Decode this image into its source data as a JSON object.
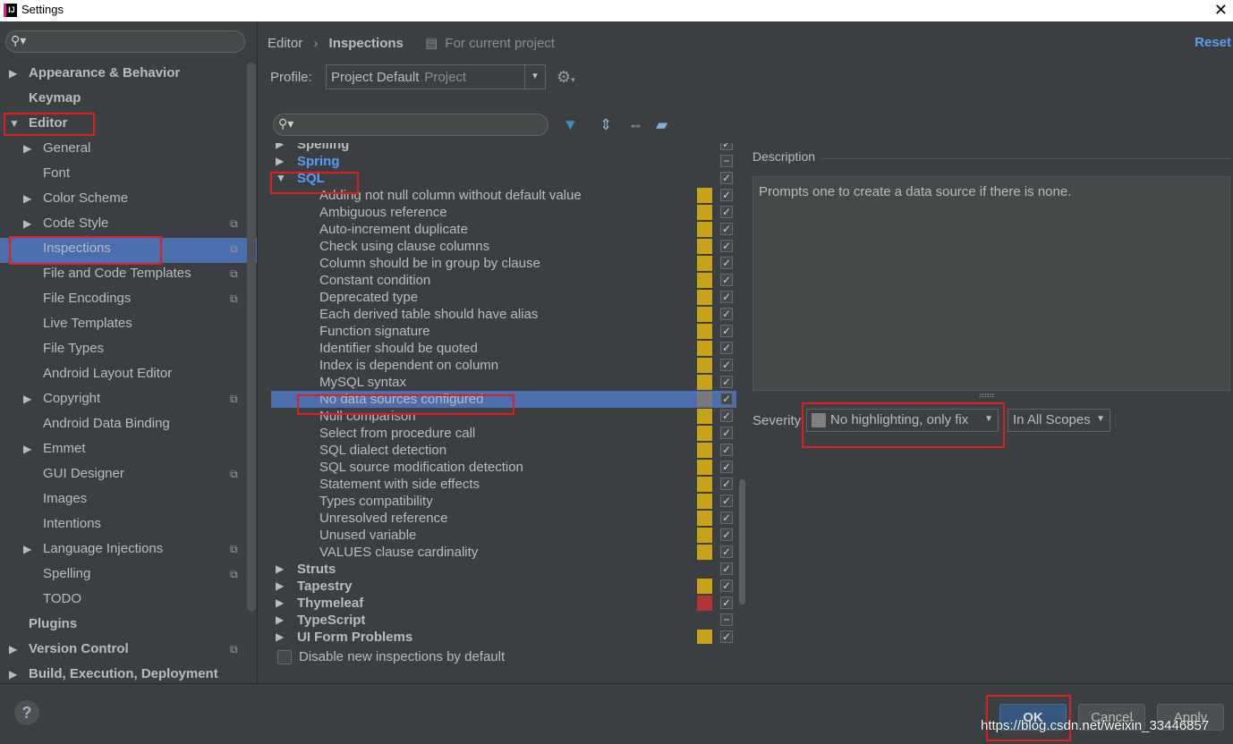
{
  "window": {
    "title": "Settings"
  },
  "left": {
    "search_placeholder": "",
    "items": [
      {
        "label": "Appearance & Behavior",
        "arrow": "▶"
      },
      {
        "label": "Keymap",
        "arrow": ""
      },
      {
        "label": "Editor",
        "arrow": "▼"
      },
      {
        "label": "General",
        "arrow": "▶"
      },
      {
        "label": "Font",
        "arrow": ""
      },
      {
        "label": "Color Scheme",
        "arrow": "▶"
      },
      {
        "label": "Code Style",
        "arrow": "▶"
      },
      {
        "label": "Inspections",
        "arrow": ""
      },
      {
        "label": "File and Code Templates",
        "arrow": ""
      },
      {
        "label": "File Encodings",
        "arrow": ""
      },
      {
        "label": "Live Templates",
        "arrow": ""
      },
      {
        "label": "File Types",
        "arrow": ""
      },
      {
        "label": "Android Layout Editor",
        "arrow": ""
      },
      {
        "label": "Copyright",
        "arrow": "▶"
      },
      {
        "label": "Android Data Binding",
        "arrow": ""
      },
      {
        "label": "Emmet",
        "arrow": "▶"
      },
      {
        "label": "GUI Designer",
        "arrow": ""
      },
      {
        "label": "Images",
        "arrow": ""
      },
      {
        "label": "Intentions",
        "arrow": ""
      },
      {
        "label": "Language Injections",
        "arrow": "▶"
      },
      {
        "label": "Spelling",
        "arrow": ""
      },
      {
        "label": "TODO",
        "arrow": ""
      },
      {
        "label": "Plugins",
        "arrow": ""
      },
      {
        "label": "Version Control",
        "arrow": "▶"
      },
      {
        "label": "Build, Execution, Deployment",
        "arrow": "▶"
      }
    ]
  },
  "header": {
    "crumb1": "Editor",
    "separator": "›",
    "crumb2": "Inspections",
    "scope_note": "For current project",
    "reset": "Reset"
  },
  "profile": {
    "label": "Profile:",
    "value": "Project Default",
    "hint": "Project"
  },
  "inspections": {
    "groups_top": [
      {
        "label": "Spelling",
        "arrow": "▶"
      },
      {
        "label": "Spring",
        "arrow": "▶"
      },
      {
        "label": "SQL",
        "arrow": "▼"
      }
    ],
    "sql_children": [
      "Adding not null column without default value",
      "Ambiguous reference",
      "Auto-increment duplicate",
      "Check using clause columns",
      "Column should be in group by clause",
      "Constant condition",
      "Deprecated type",
      "Each derived table should have alias",
      "Function signature",
      "Identifier should be quoted",
      "Index is dependent on column",
      "MySQL syntax",
      "No data sources configured",
      "Null comparison",
      "Select from procedure call",
      "SQL dialect detection",
      "SQL source modification detection",
      "Statement with side effects",
      "Types compatibility",
      "Unresolved reference",
      "Unused variable",
      "VALUES clause cardinality"
    ],
    "groups_bottom": [
      {
        "label": "Struts",
        "arrow": "▶"
      },
      {
        "label": "Tapestry",
        "arrow": "▶"
      },
      {
        "label": "Thymeleaf",
        "arrow": "▶"
      },
      {
        "label": "TypeScript",
        "arrow": "▶"
      },
      {
        "label": "UI Form Problems",
        "arrow": "▶"
      }
    ],
    "selected": "No data sources configured",
    "colors": {
      "warning": "#c9a21c",
      "error": "#b03535",
      "none": "#808080"
    }
  },
  "description": {
    "label": "Description",
    "text": "Prompts one to create a data source if there is none."
  },
  "severity": {
    "label": "Severity:",
    "value": "No highlighting, only fix",
    "scope": "In All Scopes"
  },
  "options": {
    "disable_new": "Disable new inspections by default"
  },
  "buttons": {
    "help": "?",
    "ok": "OK",
    "cancel": "Cancel",
    "apply": "Apply"
  },
  "watermark": "https://blog.csdn.net/weixin_33446857",
  "icons": {
    "search": "search-icon",
    "filter": "filter-icon",
    "expand_all": "expand-all-icon",
    "collapse_all": "collapse-all-icon",
    "eraser": "eraser-icon",
    "gear": "gear-icon"
  }
}
